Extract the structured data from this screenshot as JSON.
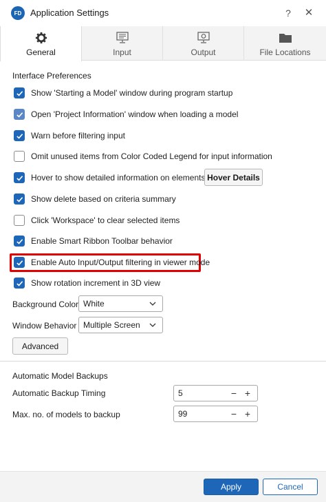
{
  "window": {
    "logo_text": "FD",
    "title": "Application Settings",
    "help_glyph": "?",
    "close_glyph": "✕"
  },
  "tabs": [
    {
      "label": "General",
      "icon": "gear-icon",
      "active": true
    },
    {
      "label": "Input",
      "icon": "input-monitor-icon",
      "active": false
    },
    {
      "label": "Output",
      "icon": "output-monitor-icon",
      "active": false
    },
    {
      "label": "File Locations",
      "icon": "folder-icon",
      "active": false
    }
  ],
  "interface": {
    "title": "Interface Preferences",
    "options": [
      {
        "label": "Show 'Starting a Model' window during program startup",
        "checked": true
      },
      {
        "label": "Open 'Project Information' window when loading a model",
        "checked": true
      },
      {
        "label": "Warn before filtering input",
        "checked": true
      },
      {
        "label": "Omit unused items from Color Coded Legend for input information",
        "checked": false
      },
      {
        "label": "Hover to show detailed information on elements",
        "checked": true
      },
      {
        "label": "Show delete based on criteria summary",
        "checked": true
      },
      {
        "label": "Click 'Workspace' to clear selected items",
        "checked": false
      },
      {
        "label": "Enable Smart Ribbon Toolbar behavior",
        "checked": true
      },
      {
        "label": "Enable Auto Input/Output filtering in viewer mode",
        "checked": true
      },
      {
        "label": "Show rotation increment in 3D view",
        "checked": true
      }
    ],
    "hover_details_label": "Hover Details",
    "background_color_label": "Background Color",
    "background_color_value": "White",
    "window_behavior_label": "Window Behavior",
    "window_behavior_value": "Multiple Screen",
    "advanced_label": "Advanced"
  },
  "backups": {
    "title": "Automatic Model Backups",
    "timing_label": "Automatic Backup Timing",
    "timing_value": "5",
    "max_label": "Max. no. of models to backup",
    "max_value": "99",
    "minus_glyph": "−",
    "plus_glyph": "+"
  },
  "footer": {
    "apply_label": "Apply",
    "cancel_label": "Cancel"
  },
  "colors": {
    "accent": "#1d66b8",
    "highlight": "#e00000"
  }
}
